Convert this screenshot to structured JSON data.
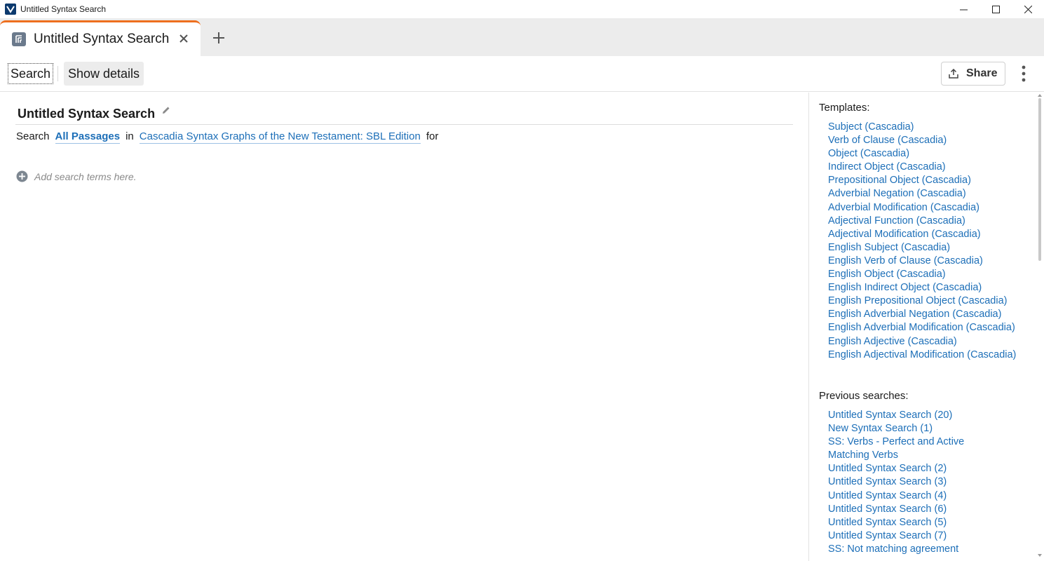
{
  "window": {
    "title": "Untitled Syntax Search"
  },
  "tabs": [
    {
      "label": "Untitled Syntax Search",
      "active": true
    }
  ],
  "toolbar": {
    "search_label": "Search",
    "details_label": "Show details",
    "share_label": "Share"
  },
  "main": {
    "title": "Untitled Syntax Search",
    "search_word": "Search",
    "scope": "All Passages",
    "in_word": "in",
    "resource": "Cascadia Syntax Graphs of the New Testament: SBL Edition",
    "for_word": "for",
    "add_terms_placeholder": "Add search terms here."
  },
  "sidebar": {
    "templates_heading": "Templates:",
    "templates": [
      "Subject (Cascadia)",
      "Verb of Clause (Cascadia)",
      "Object (Cascadia)",
      "Indirect Object (Cascadia)",
      "Prepositional Object (Cascadia)",
      "Adverbial Negation (Cascadia)",
      "Adverbial Modification (Cascadia)",
      "Adjectival Function (Cascadia)",
      "Adjectival Modification (Cascadia)",
      "English Subject (Cascadia)",
      "English Verb of Clause (Cascadia)",
      "English Object (Cascadia)",
      "English Indirect Object (Cascadia)",
      "English Prepositional Object (Cascadia)",
      "English Adverbial Negation (Cascadia)",
      "English Adverbial Modification (Cascadia)",
      "English Adjective (Cascadia)",
      "English Adjectival Modification (Cascadia)"
    ],
    "previous_heading": "Previous searches:",
    "previous": [
      "Untitled Syntax Search (20)",
      "New Syntax Search (1)",
      "SS: Verbs - Perfect and Active",
      "Matching Verbs",
      "Untitled Syntax Search (2)",
      "Untitled Syntax Search (3)",
      "Untitled Syntax Search (4)",
      "Untitled Syntax Search (6)",
      "Untitled Syntax Search (5)",
      "Untitled Syntax Search (7)",
      "SS: Not matching agreement"
    ]
  },
  "colors": {
    "accent_tab": "#ee6f1e",
    "link": "#1d6fb8",
    "app_icon": "#0d3a6e"
  },
  "icons": {
    "app": "logos-app-icon",
    "tab": "syntax-search-icon",
    "close": "close-icon",
    "new_tab": "plus-icon",
    "share": "share-upload-icon",
    "more": "vertical-ellipsis-icon",
    "edit": "pencil-icon",
    "add": "add-circle-icon"
  }
}
